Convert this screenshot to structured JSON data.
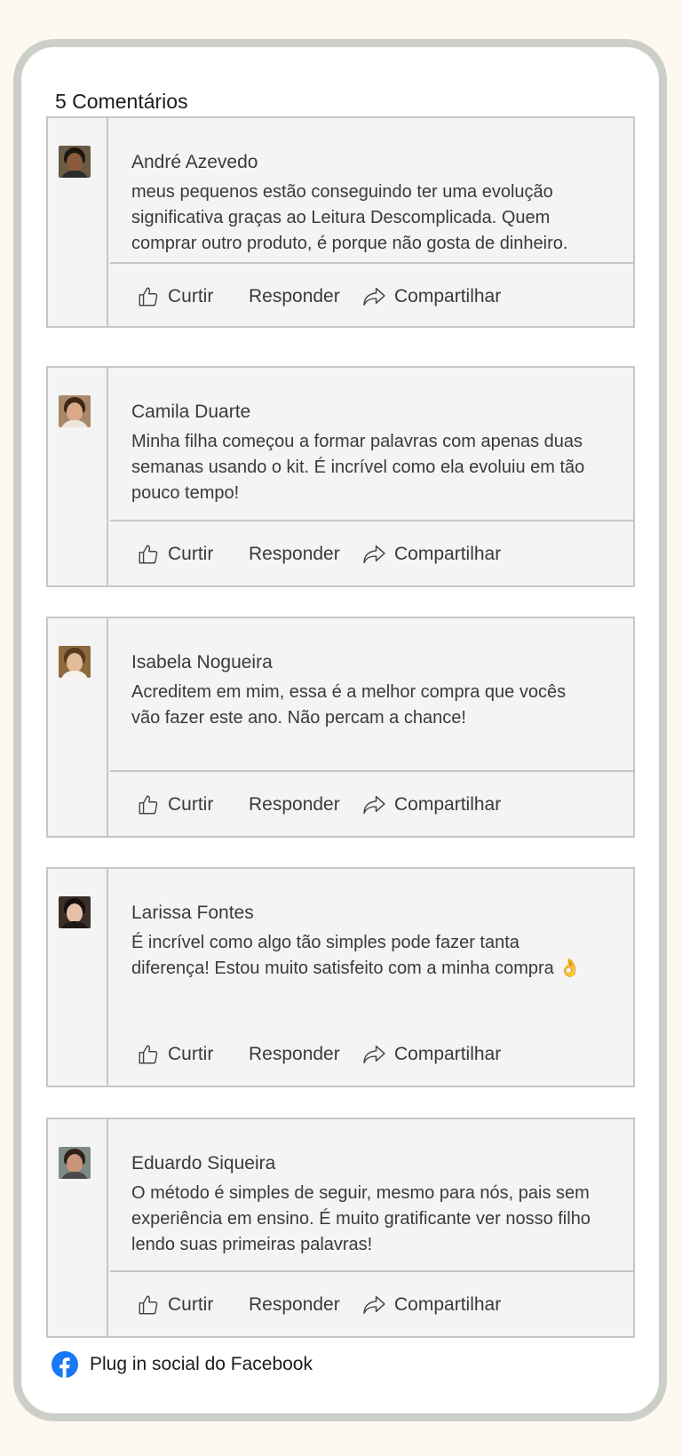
{
  "header": {
    "count_label": "5 Comentários"
  },
  "actions": {
    "like": "Curtir",
    "reply": "Responder",
    "share": "Compartilhar"
  },
  "comments": [
    {
      "name": "André Azevedo",
      "text": "meus pequenos estão conseguindo ter uma evolução significativa graças ao Leitura Descomplicada. Quem comprar outro produto, é porque não gosta de dinheiro."
    },
    {
      "name": "Camila Duarte",
      "text": "Minha filha começou a formar palavras com apenas duas semanas usando o kit. É incrível como ela evoluiu em tão pouco tempo!"
    },
    {
      "name": "Isabela Nogueira",
      "text": "Acreditem em mim, essa é a melhor compra que vocês vão fazer este ano. Não percam a chance!"
    },
    {
      "name": "Larissa Fontes",
      "text": "É incrível como algo tão simples pode fazer tanta diferença! Estou muito satisfeito com a minha compra 👌"
    },
    {
      "name": "Eduardo Siqueira",
      "text": "O método é simples de seguir, mesmo para nós, pais sem experiência em ensino. É muito gratificante ver nosso filho lendo suas primeiras palavras!"
    }
  ],
  "footer": {
    "label": "Plug in social do Facebook",
    "icon": "facebook-icon"
  },
  "colors": {
    "facebook_blue": "#1877f2",
    "border": "#c6c6c6",
    "comment_bg": "#f4f4f4"
  }
}
